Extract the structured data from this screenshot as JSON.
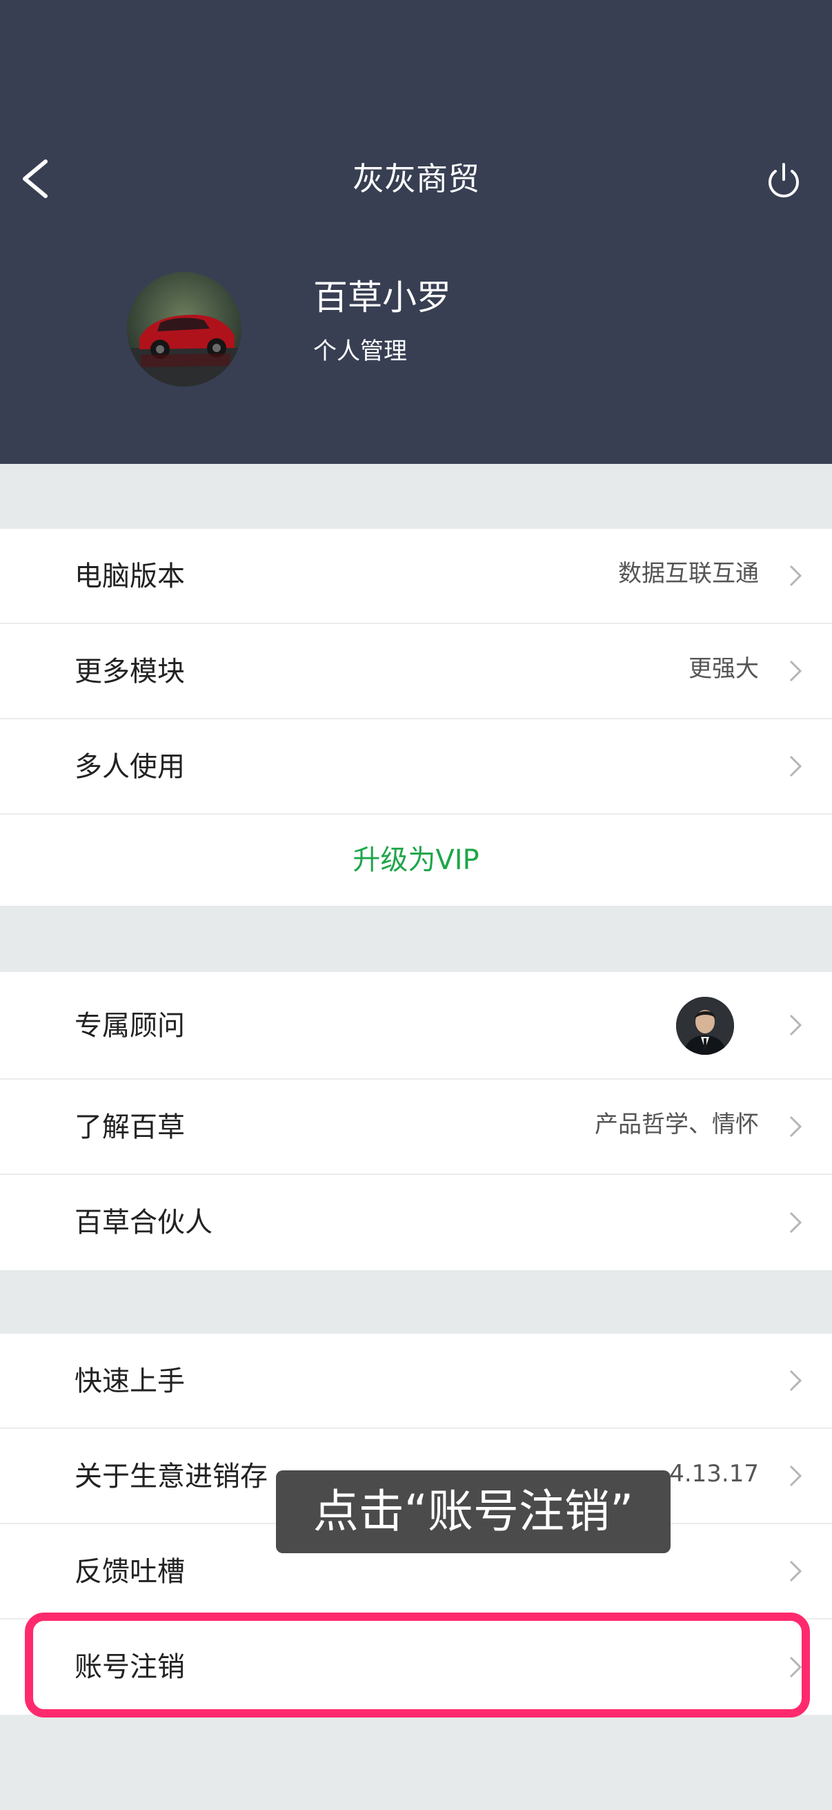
{
  "header": {
    "title": "灰灰商贸",
    "user_name": "百草小罗",
    "user_sub": "个人管理"
  },
  "group1": {
    "items": [
      {
        "label": "电脑版本",
        "value": "数据互联互通"
      },
      {
        "label": "更多模块",
        "value": "更强大"
      },
      {
        "label": "多人使用",
        "value": ""
      }
    ],
    "vip_label": "升级为VIP"
  },
  "group2": {
    "items": [
      {
        "label": "专属顾问",
        "value": ""
      },
      {
        "label": "了解百草",
        "value": "产品哲学、情怀"
      },
      {
        "label": "百草合伙人",
        "value": ""
      }
    ]
  },
  "group3": {
    "items": [
      {
        "label": "快速上手",
        "value": ""
      },
      {
        "label": "关于生意进销存",
        "value": "4.13.17"
      },
      {
        "label": "反馈吐槽",
        "value": ""
      },
      {
        "label": "账号注销",
        "value": ""
      }
    ]
  },
  "overlay": {
    "toast_text": "点击“账号注销”"
  },
  "colors": {
    "header_bg": "#383f53",
    "page_bg": "#e6eaea",
    "vip_green": "#1fa64a",
    "highlight_pink": "#ff2a6e"
  },
  "icons": {
    "back": "chevron-left-icon",
    "power": "power-icon",
    "row_arrow": "chevron-right-icon"
  }
}
